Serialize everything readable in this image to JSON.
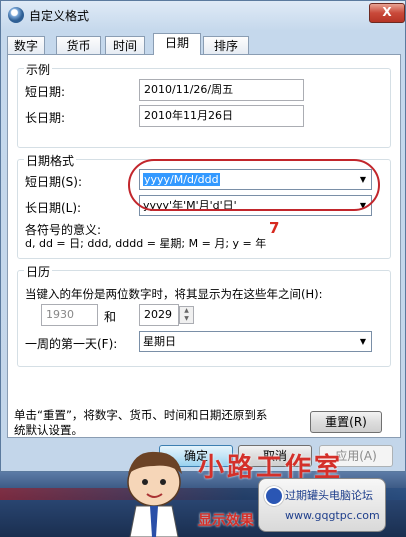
{
  "window": {
    "title": "自定义格式",
    "close_glyph": "X"
  },
  "tabs": [
    "数字",
    "货币",
    "时间",
    "日期",
    "排序"
  ],
  "active_tab": "日期",
  "examples": {
    "title": "示例",
    "short_label": "短日期:",
    "short_value": "2010/11/26/周五",
    "long_label": "长日期:",
    "long_value": "2010年11月26日"
  },
  "format": {
    "title": "日期格式",
    "short_label": "短日期(S):",
    "short_value": "yyyy/M/d/ddd",
    "long_label": "长日期(L):",
    "long_value": "yyyy'年'M'月'd'日'",
    "symbols_title": "各符号的意义:",
    "symbols_text": "d, dd = 日;  ddd, dddd = 星期;  M = 月;  y = 年"
  },
  "annotation": {
    "number": "7"
  },
  "calendar": {
    "title": "日历",
    "two_digit_text": "当键入的年份是两位数字时，将其显示为在这些年之间(H):",
    "year_from": "1930",
    "and_label": "和",
    "year_to": "2029",
    "first_day_label": "一周的第一天(F):",
    "first_day_value": "星期日"
  },
  "reset": {
    "text_line1": "单击“重置”，将数字、货币、时间和日期还原到系",
    "text_line2": "统默认设置。",
    "button": "重置(R)"
  },
  "buttons": {
    "ok": "确定",
    "cancel": "取消",
    "apply": "应用(A)"
  },
  "watermarks": {
    "logo_text": "小路工作室",
    "red_bottom": "显示效果",
    "badge_line1": "过期罐头电脑论坛",
    "badge_line2": "www.gqgtpc.com"
  },
  "colors": {
    "highlight": "#3399ff",
    "annotation_red": "#c2262c"
  }
}
